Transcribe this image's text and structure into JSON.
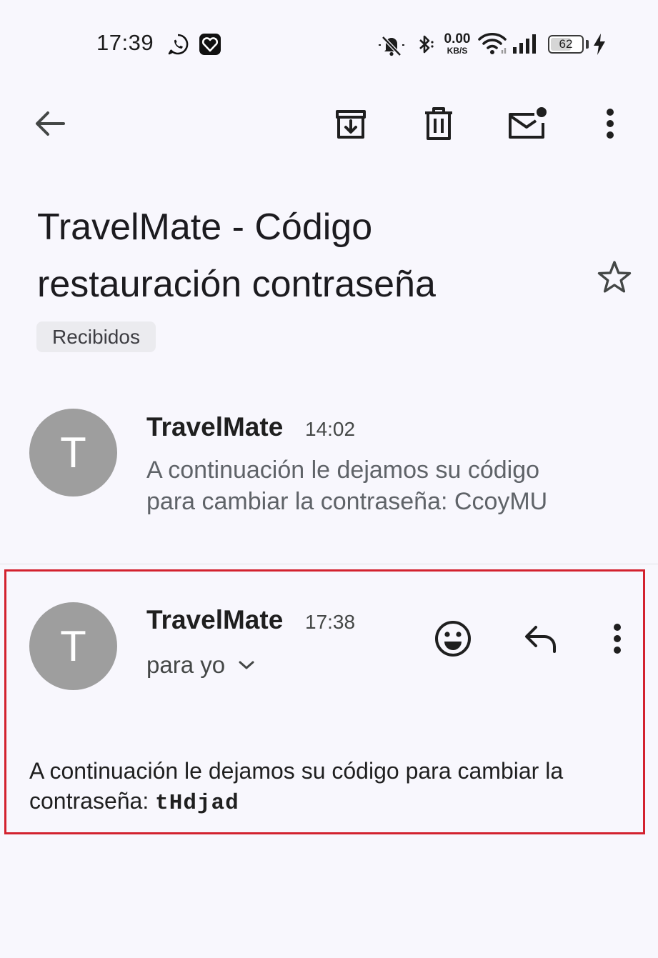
{
  "status_bar": {
    "time": "17:39",
    "net_speed_value": "0.00",
    "net_speed_unit": "KB/S",
    "battery_level": "62",
    "icons": [
      "whatsapp-icon",
      "app-heart-icon",
      "bell-muted-icon",
      "bluetooth-icon",
      "wifi-icon",
      "cell-signal-icon",
      "charging-icon"
    ]
  },
  "toolbar": {
    "icons": [
      "back-arrow-icon",
      "archive-icon",
      "delete-icon",
      "mark-unread-icon",
      "more-vert-icon"
    ]
  },
  "subject": {
    "line1": "TravelMate - Código",
    "line2": "restauración contraseña"
  },
  "label": "Recibidos",
  "messages": [
    {
      "avatar_letter": "T",
      "sender": "TravelMate",
      "time": "14:02",
      "snippet_line1": "A continuación le dejamos su código",
      "snippet_line2": "para cambiar la contraseña: CcoyMU"
    },
    {
      "avatar_letter": "T",
      "sender": "TravelMate",
      "time": "17:38",
      "recipient": "para yo",
      "body_line1": "A continuación le dejamos su código para cambiar la",
      "body_prefix": "contraseña: ",
      "code": "tHdjad"
    }
  ],
  "colors": {
    "background": "#f8f7fd",
    "avatar": "#9e9e9e",
    "highlight_border": "#d3222f",
    "chip": "#ebebef"
  }
}
